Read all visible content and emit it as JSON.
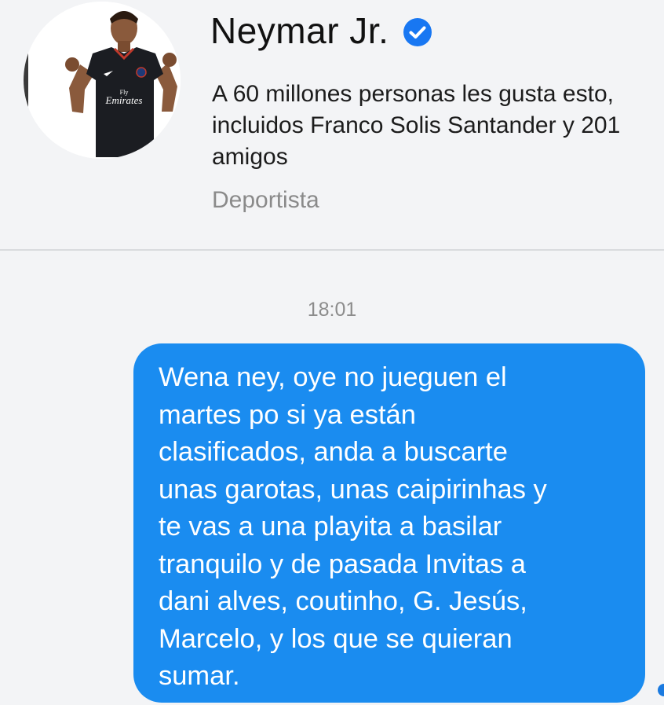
{
  "profile": {
    "name": "Neymar Jr.",
    "verified": true,
    "likes_text": "A 60 millones personas les gusta esto, incluidos Franco Solis Santander y 201 amigos",
    "category": "Deportista",
    "avatar_icon": "profile-photo",
    "jersey_text": "Fly Emirates"
  },
  "conversation": {
    "timestamp": "18:01",
    "messages": [
      {
        "sender": "me",
        "text": "Wena ney, oye no jueguen el\nmartes po si ya están\nclasificados, anda a buscarte\nunas garotas, unas caipirinhas y\nte vas a una playita a basilar\ntranquilo y de pasada Invitas a\ndani alves, coutinho, G. Jesús,\nMarcelo, y los que se quieran\nsumar."
      }
    ]
  },
  "colors": {
    "accent_blue": "#1a8cf0",
    "verified_blue": "#1877f2",
    "background": "#f3f4f6",
    "muted_text": "#8a8a8a"
  }
}
